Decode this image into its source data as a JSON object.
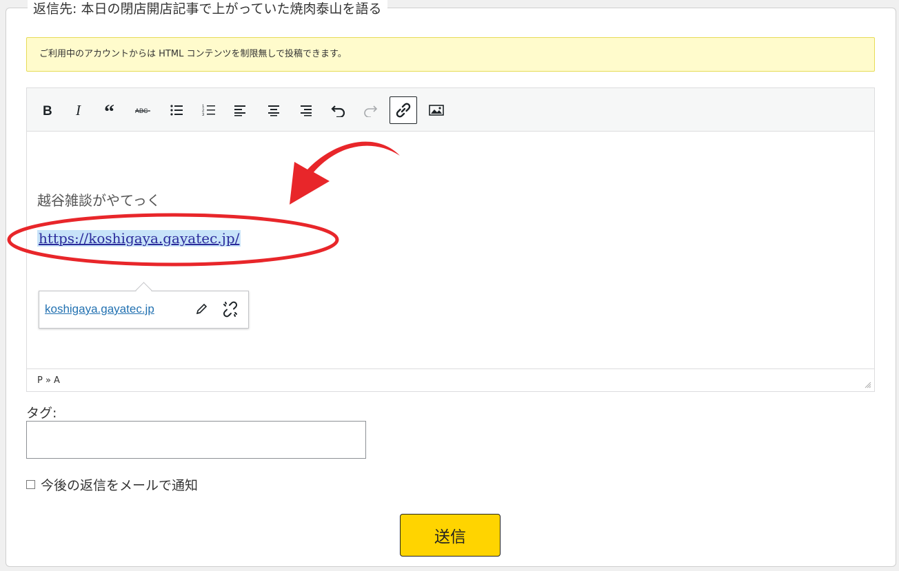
{
  "form": {
    "legend": "返信先: 本日の閉店開店記事で上がっていた焼肉泰山を語る",
    "notice": "ご利用中のアカウントからは HTML コンテンツを制限無しで投稿できます。"
  },
  "toolbar": {
    "buttons": [
      {
        "name": "bold",
        "icon": "bold-icon"
      },
      {
        "name": "italic",
        "icon": "italic-icon"
      },
      {
        "name": "blockquote",
        "icon": "quote-icon"
      },
      {
        "name": "strikethrough",
        "icon": "strikethrough-icon"
      },
      {
        "name": "bullet-list",
        "icon": "bullet-list-icon"
      },
      {
        "name": "numbered-list",
        "icon": "numbered-list-icon"
      },
      {
        "name": "align-left",
        "icon": "align-left-icon"
      },
      {
        "name": "align-center",
        "icon": "align-center-icon"
      },
      {
        "name": "align-right",
        "icon": "align-right-icon"
      },
      {
        "name": "undo",
        "icon": "undo-icon"
      },
      {
        "name": "redo",
        "icon": "redo-icon"
      },
      {
        "name": "insert-link",
        "icon": "link-icon",
        "active": true
      },
      {
        "name": "insert-image",
        "icon": "image-icon"
      }
    ]
  },
  "editor": {
    "paragraph": "越谷雑談がやてっく",
    "link_text": "https://koshigaya.gayatec.jp/",
    "popup_link": "koshigaya.gayatec.jp",
    "path": "P » A"
  },
  "tags": {
    "label": "タグ:",
    "value": ""
  },
  "notify": {
    "label": "今後の返信をメールで通知",
    "checked": false
  },
  "submit": {
    "label": "送信"
  },
  "colors": {
    "notice_bg": "#fffbcc",
    "submit_bg": "#ffd400",
    "annotation": "#e8262a"
  }
}
